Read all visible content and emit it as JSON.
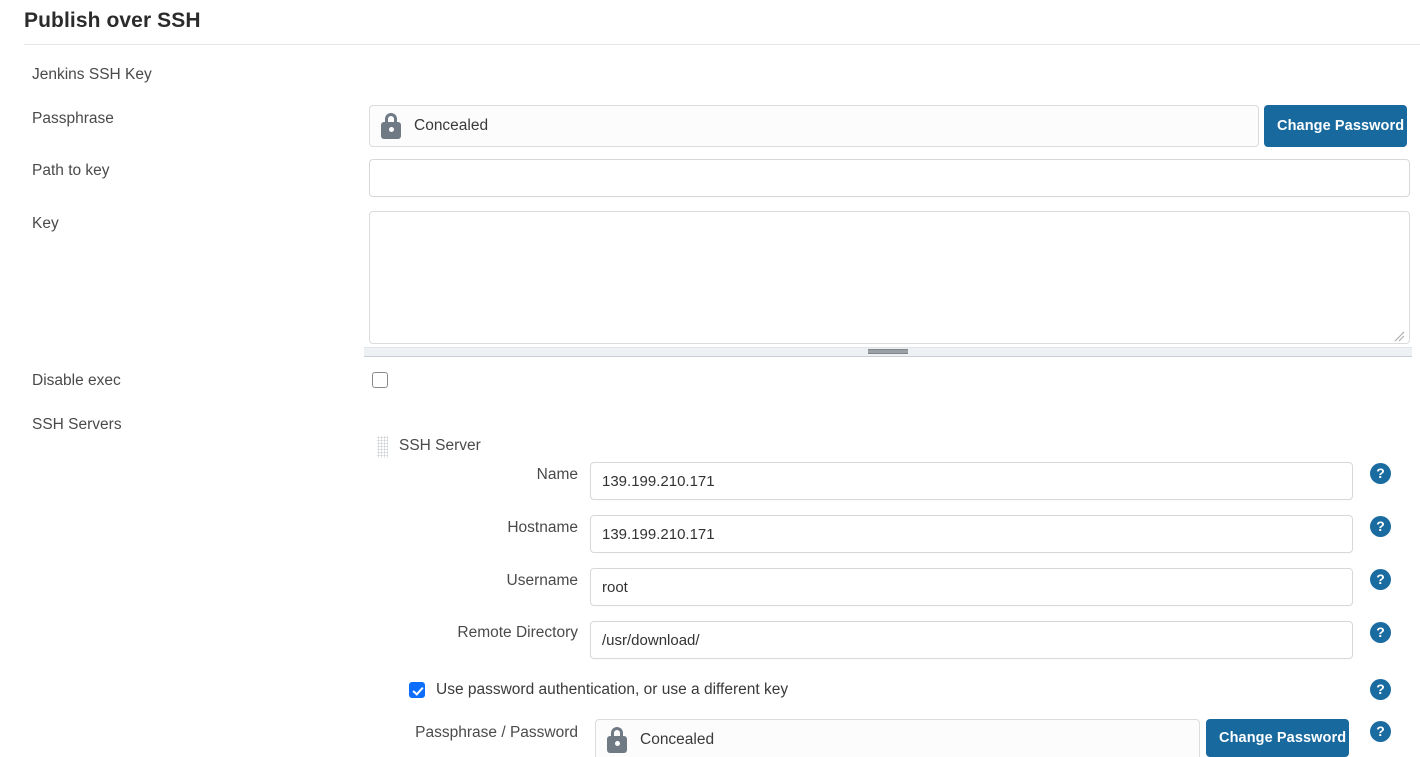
{
  "header": {
    "title": "Publish over SSH"
  },
  "jenkins_key": {
    "section_label": "Jenkins SSH Key",
    "passphrase": {
      "label": "Passphrase",
      "value": "Concealed",
      "lock_icon": "lock-icon",
      "button_label": "Change Password"
    },
    "path_to_key": {
      "label": "Path to key",
      "value": "",
      "placeholder": ""
    },
    "key": {
      "label": "Key",
      "value": "",
      "placeholder": ""
    }
  },
  "disable_exec": {
    "label": "Disable exec",
    "checked": false
  },
  "ssh_servers": {
    "label": "SSH Servers",
    "block_title": "SSH Server",
    "drag_handle_icon": "drag-dots-icon",
    "fields": [
      {
        "label": "Name",
        "value": "139.199.210.171",
        "help": "?"
      },
      {
        "label": "Hostname",
        "value": "139.199.210.171",
        "help": "?"
      },
      {
        "label": "Username",
        "value": "root",
        "help": "?"
      },
      {
        "label": "Remote Directory",
        "value": "/usr/download/",
        "help": "?"
      }
    ],
    "use_password_auth": {
      "label": "Use password authentication, or use a different key",
      "checked": true,
      "help": "?"
    },
    "passphrase_password": {
      "label": "Passphrase / Password",
      "value": "Concealed",
      "lock_icon": "lock-icon",
      "button_label": "Change Password",
      "help": "?"
    }
  },
  "colors": {
    "button_blue": "#17699e",
    "help_blue": "#1a6ba0",
    "checkbox_blue": "#0d6efd",
    "lock_grey": "#6f7a85",
    "border_grey": "#d8d8d8",
    "text": "#333333"
  }
}
